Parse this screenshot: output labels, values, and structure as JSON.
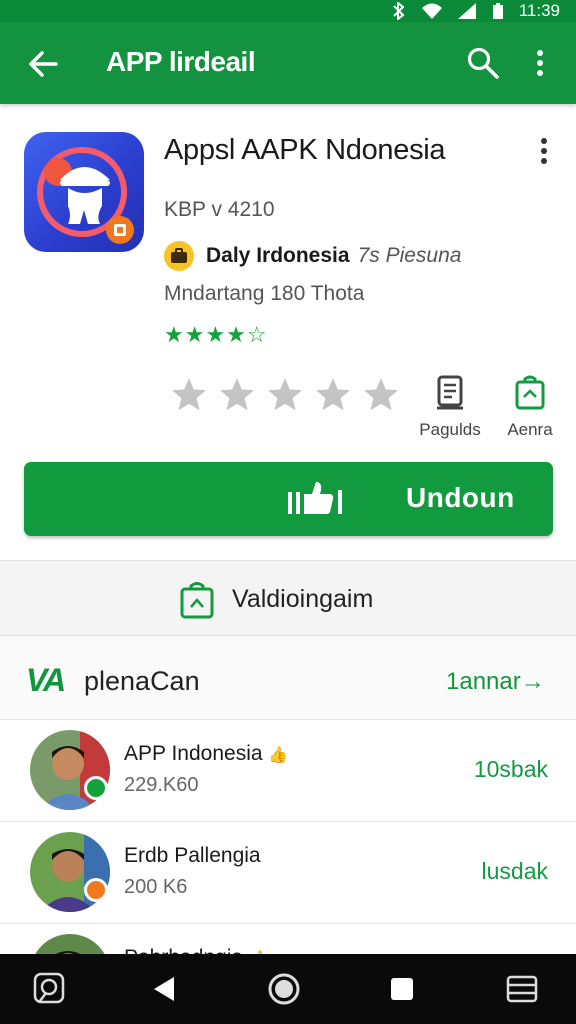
{
  "status_bar": {
    "time": "11:39"
  },
  "app_bar": {
    "title": "APP lirdeail"
  },
  "app": {
    "name": "Appsl AAPK Ndonesia",
    "version": "KBP v 4210",
    "developer_name": "Daly Irdonesia",
    "developer_sub": "7s Piesuna",
    "downloads": "Mndartang 180 Thota",
    "rating_stars": "★★★★☆",
    "rating_value": 4
  },
  "rate": {
    "stars": 5,
    "filled": 0
  },
  "actions": {
    "pages_label": "Pagulds",
    "aenra_label": "Aenra"
  },
  "install": {
    "label": "Undoun"
  },
  "validation": {
    "label": "Valdioingaim"
  },
  "section": {
    "logo": "VA",
    "title": "plenaCan",
    "link": "1annar→"
  },
  "list": [
    {
      "name": "APP Indonesia",
      "name_emoji": "👍",
      "meta": "229.K60",
      "count": "10sbak",
      "badge_color": "#16a23a"
    },
    {
      "name": "Erdb Pallengia",
      "name_emoji": "",
      "meta": "200 K6",
      "count": "lusdak",
      "badge_color": "#f0791e"
    },
    {
      "name": "Pabrbadngia",
      "name_emoji": "👍",
      "meta": "",
      "count": "",
      "badge_color": "#16a23a"
    }
  ],
  "colors": {
    "primary": "#13923f",
    "status": "#0b8a3a",
    "accent_text": "#149a42",
    "star_grey": "#c4c4c4"
  }
}
